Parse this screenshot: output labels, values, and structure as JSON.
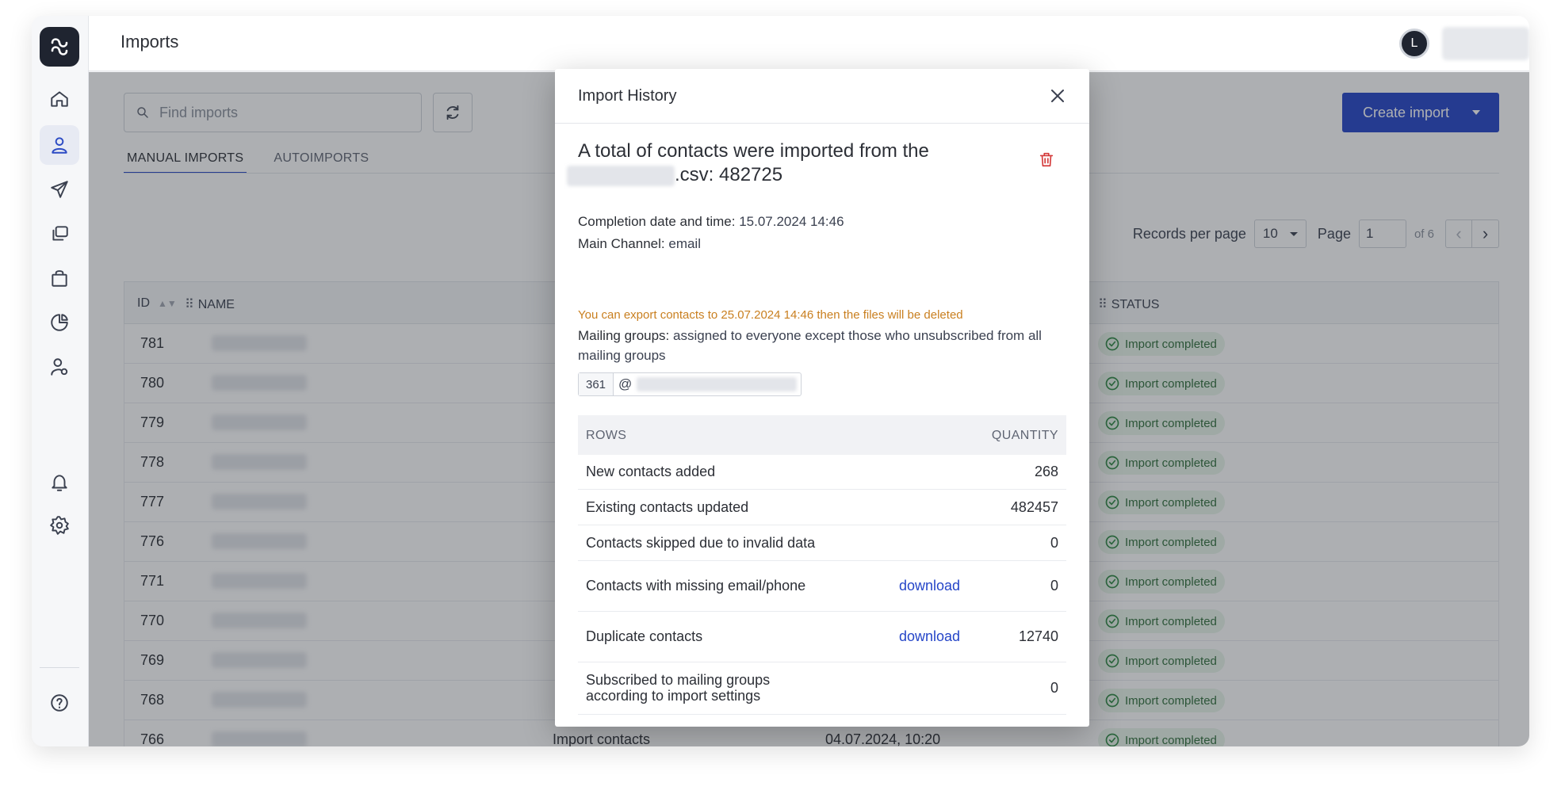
{
  "header": {
    "title": "Imports",
    "avatar_initial": "L"
  },
  "search": {
    "placeholder": "Find imports"
  },
  "create_button": {
    "label": "Create import"
  },
  "tabs": [
    {
      "label": "MANUAL IMPORTS",
      "active": true
    },
    {
      "label": "AUTOIMPORTS",
      "active": false
    }
  ],
  "pagination": {
    "records_label": "Records per page",
    "records_value": "10",
    "page_label": "Page",
    "page_value": "1",
    "of_label": "of 6"
  },
  "table": {
    "columns": {
      "id": "ID",
      "name": "NAME",
      "status": "STATUS"
    },
    "rows": [
      {
        "id": "781",
        "status": "Import completed"
      },
      {
        "id": "780",
        "status": "Import completed"
      },
      {
        "id": "779",
        "status": "Import completed"
      },
      {
        "id": "778",
        "status": "Import completed"
      },
      {
        "id": "777",
        "status": "Import completed"
      },
      {
        "id": "776",
        "status": "Import completed"
      },
      {
        "id": "771",
        "status": "Import completed"
      },
      {
        "id": "770",
        "status": "Import completed"
      },
      {
        "id": "769",
        "status": "Import completed"
      },
      {
        "id": "768",
        "status": "Import completed"
      },
      {
        "id": "766",
        "type": "Import contacts",
        "date": "04.07.2024, 10:20",
        "status": "Import completed"
      }
    ]
  },
  "modal": {
    "title": "Import History",
    "headline_prefix": "A total of contacts were imported from the",
    "headline_file_suffix": ".csv: 482725",
    "completion_label": "Completion date and time:",
    "completion_value": "15.07.2024 14:46",
    "channel_label": "Main Channel:",
    "channel_value": "email",
    "warning": "You can export contacts to 25.07.2024 14:46 then the files will be deleted",
    "groups_label": "Mailing groups:",
    "groups_value": "assigned to everyone except those who unsubscribed from all mailing groups",
    "group_count": "361",
    "group_at": "@",
    "stats": {
      "col_rows": "ROWS",
      "col_quantity": "QUANTITY",
      "rows": [
        {
          "label": "New contacts added",
          "download": "",
          "quantity": "268"
        },
        {
          "label": "Existing contacts updated",
          "download": "",
          "quantity": "482457"
        },
        {
          "label": "Contacts skipped due to invalid data",
          "download": "",
          "quantity": "0"
        },
        {
          "label": "Contacts with missing email/phone",
          "download": "download",
          "quantity": "0"
        },
        {
          "label": "Duplicate contacts",
          "download": "download",
          "quantity": "12740"
        },
        {
          "label": "Subscribed to mailing groups according to import settings",
          "download": "",
          "quantity": "0"
        }
      ]
    }
  },
  "colors": {
    "accent": "#2545c8",
    "warning": "#c97f1f",
    "success_bg": "#e8f5ea",
    "danger": "#d43a3a"
  },
  "icons": {
    "sidebar": [
      "home-icon",
      "user-icon",
      "send-icon",
      "copy-icon",
      "bag-icon",
      "pie-chart-icon",
      "user-settings-icon",
      "bell-icon",
      "gear-icon",
      "help-icon"
    ]
  }
}
